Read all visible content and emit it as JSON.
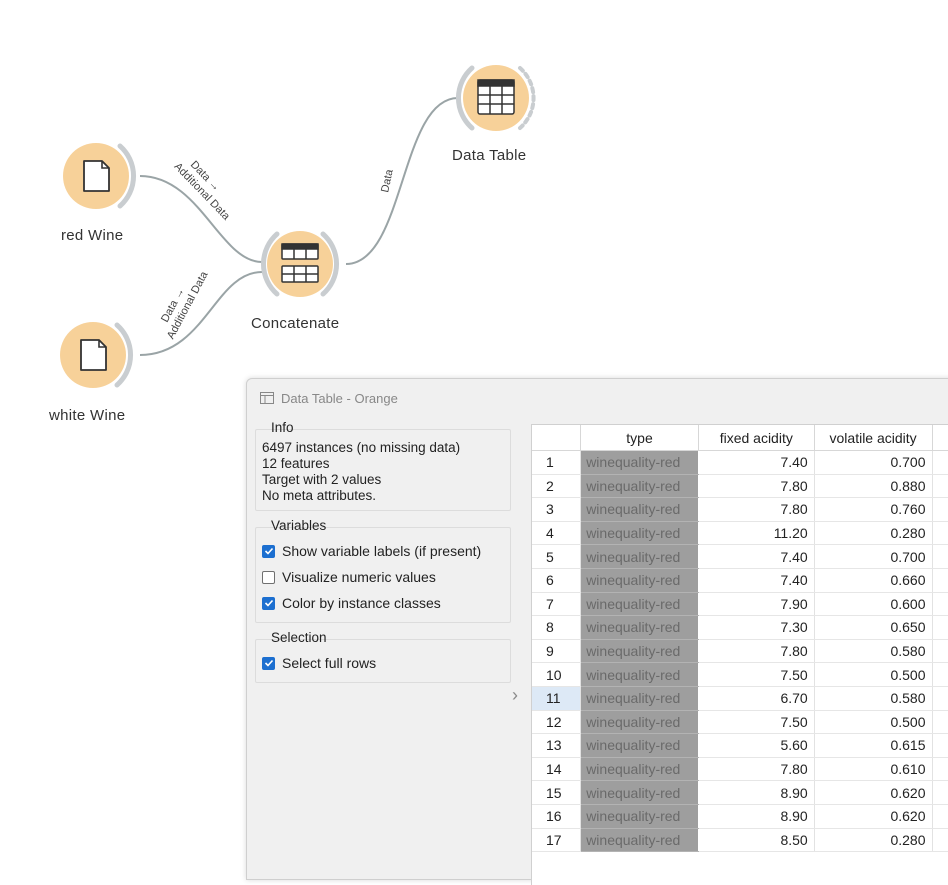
{
  "canvas": {
    "nodes": {
      "red_wine": "red Wine",
      "white_wine": "white Wine",
      "concatenate": "Concatenate",
      "data_table": "Data Table"
    },
    "links": {
      "red_to_concat": [
        "Data →",
        "Additional Data"
      ],
      "white_to_concat": [
        "Data →",
        "Additional Data"
      ],
      "concat_to_table": "Data"
    },
    "node_color": "#f6c987"
  },
  "window": {
    "title": "Data Table - Orange",
    "info": {
      "title": "Info",
      "lines": [
        "6497 instances (no missing data)",
        "12 features",
        "Target with 2 values",
        "No meta attributes."
      ]
    },
    "variables": {
      "title": "Variables",
      "show_labels": "Show variable labels (if present)",
      "visualize": "Visualize numeric values",
      "color_by": "Color by instance classes"
    },
    "selection": {
      "title": "Selection",
      "select_full_rows": "Select full rows"
    },
    "table": {
      "columns": [
        "",
        "type",
        "fixed acidity",
        "volatile acidity"
      ],
      "rows": [
        [
          "1",
          "winequality-red",
          "7.40",
          "0.700"
        ],
        [
          "2",
          "winequality-red",
          "7.80",
          "0.880"
        ],
        [
          "3",
          "winequality-red",
          "7.80",
          "0.760"
        ],
        [
          "4",
          "winequality-red",
          "11.20",
          "0.280"
        ],
        [
          "5",
          "winequality-red",
          "7.40",
          "0.700"
        ],
        [
          "6",
          "winequality-red",
          "7.40",
          "0.660"
        ],
        [
          "7",
          "winequality-red",
          "7.90",
          "0.600"
        ],
        [
          "8",
          "winequality-red",
          "7.30",
          "0.650"
        ],
        [
          "9",
          "winequality-red",
          "7.80",
          "0.580"
        ],
        [
          "10",
          "winequality-red",
          "7.50",
          "0.500"
        ],
        [
          "11",
          "winequality-red",
          "6.70",
          "0.580"
        ],
        [
          "12",
          "winequality-red",
          "7.50",
          "0.500"
        ],
        [
          "13",
          "winequality-red",
          "5.60",
          "0.615"
        ],
        [
          "14",
          "winequality-red",
          "7.80",
          "0.610"
        ],
        [
          "15",
          "winequality-red",
          "8.90",
          "0.620"
        ],
        [
          "16",
          "winequality-red",
          "8.90",
          "0.620"
        ],
        [
          "17",
          "winequality-red",
          "8.50",
          "0.280"
        ]
      ],
      "current_row": "11",
      "class_color": "#9e9e9e"
    }
  }
}
